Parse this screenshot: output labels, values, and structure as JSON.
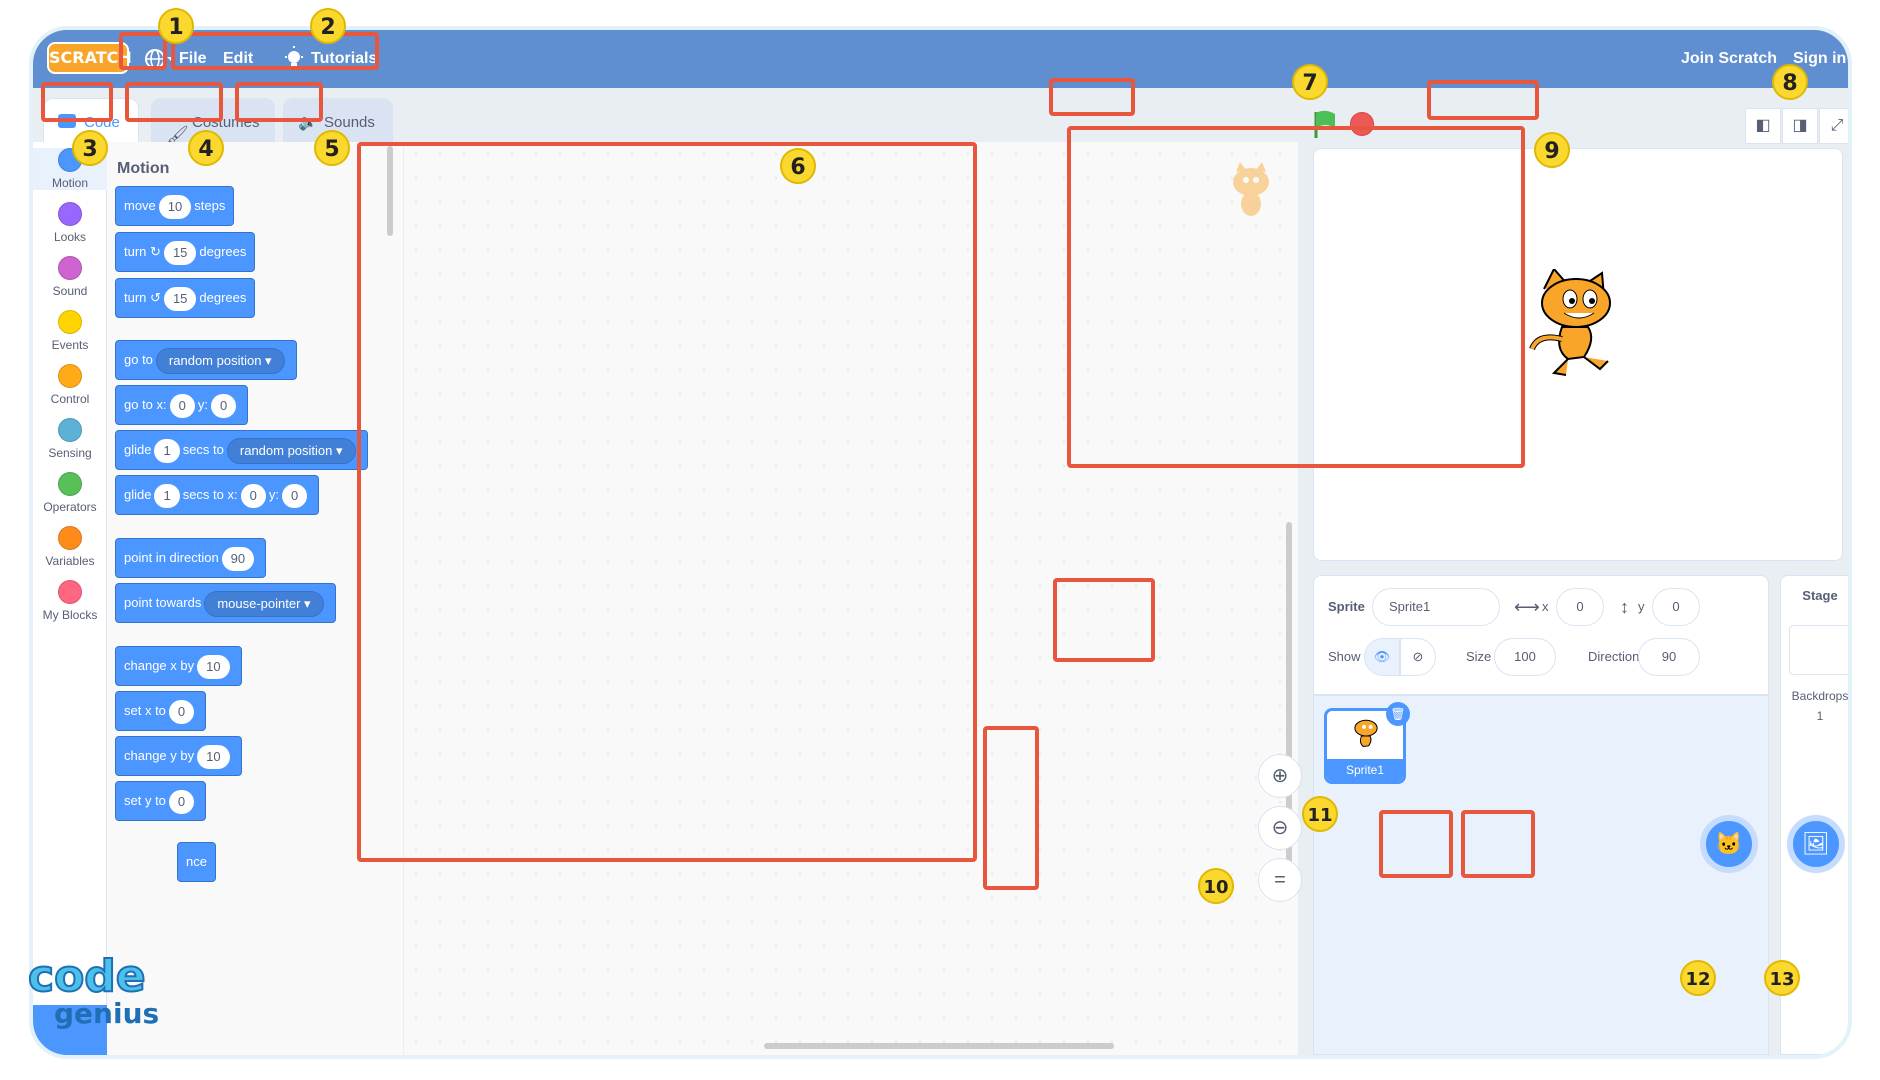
{
  "menubar": {
    "logo": "SCRATCH",
    "items": [
      "File",
      "Edit",
      "Tutorials"
    ],
    "join": "Join Scratch",
    "signin": "Sign in"
  },
  "tabs": [
    "Code",
    "Costumes",
    "Sounds"
  ],
  "categories": [
    {
      "label": "Motion",
      "color": "#4c97ff"
    },
    {
      "label": "Looks",
      "color": "#9966ff"
    },
    {
      "label": "Sound",
      "color": "#cf63cf"
    },
    {
      "label": "Events",
      "color": "#ffd500"
    },
    {
      "label": "Control",
      "color": "#ffab19"
    },
    {
      "label": "Sensing",
      "color": "#5cb1d6"
    },
    {
      "label": "Operators",
      "color": "#59c059"
    },
    {
      "label": "Variables",
      "color": "#ff8c1a"
    },
    {
      "label": "My Blocks",
      "color": "#ff6680"
    }
  ],
  "palette": {
    "heading": "Motion",
    "move": {
      "a": "move",
      "v": "10",
      "b": "steps"
    },
    "turn_right": {
      "a": "turn",
      "v": "15",
      "b": "degrees"
    },
    "turn_left": {
      "a": "turn",
      "v": "15",
      "b": "degrees"
    },
    "goto": {
      "a": "go to",
      "dd": "random position"
    },
    "goto_xy": {
      "a": "go to x:",
      "x": "0",
      "b": "y:",
      "y": "0"
    },
    "glide": {
      "a": "glide",
      "v": "1",
      "b": "secs to",
      "dd": "random position"
    },
    "glide_xy": {
      "a": "glide",
      "v": "1",
      "b": "secs to x:",
      "x": "0",
      "c": "y:",
      "y": "0"
    },
    "point_dir": {
      "a": "point in direction",
      "v": "90"
    },
    "point_towards": {
      "a": "point towards",
      "dd": "mouse-pointer"
    },
    "change_x": {
      "a": "change x by",
      "v": "10"
    },
    "set_x": {
      "a": "set x to",
      "v": "0"
    },
    "change_y": {
      "a": "change y by",
      "v": "10"
    },
    "set_y": {
      "a": "set y to",
      "v": "0"
    },
    "bounce_partial": "nce"
  },
  "sprite_info": {
    "sprite_label": "Sprite",
    "sprite_name": "Sprite1",
    "x_label": "x",
    "x_val": "0",
    "y_label": "y",
    "y_val": "0",
    "show_label": "Show",
    "size_label": "Size",
    "size_val": "100",
    "direction_label": "Direction",
    "direction_val": "90"
  },
  "sprite_thumb": {
    "name": "Sprite1"
  },
  "stage_panel": {
    "title": "Stage",
    "backdrops_label": "Backdrops",
    "backdrops_count": "1"
  },
  "badges": [
    "1",
    "2",
    "3",
    "4",
    "5",
    "6",
    "7",
    "8",
    "9",
    "10",
    "11",
    "12",
    "13"
  ],
  "watermark": {
    "line1": "code",
    "line2": "genius"
  },
  "colors": {
    "menubar": "#5f8fd0",
    "highlight": "#e8573d",
    "badge": "#fbd82d",
    "motion": "#4c97ff"
  }
}
